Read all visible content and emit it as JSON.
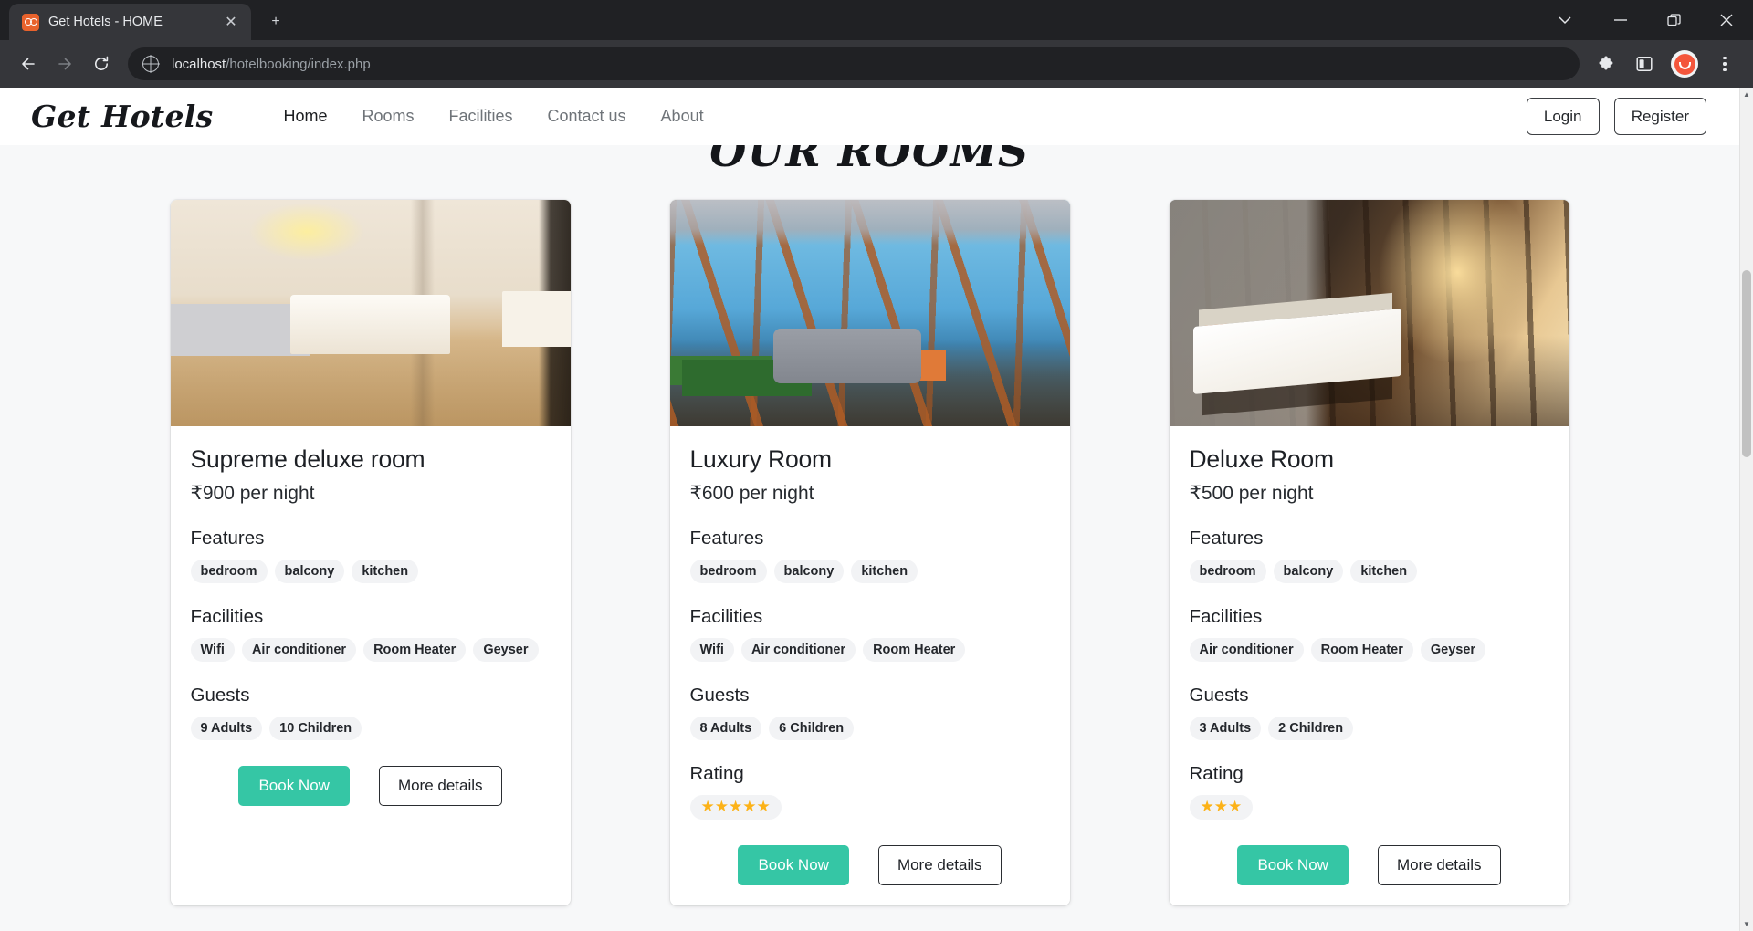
{
  "browser": {
    "tab": {
      "title": "Get Hotels - HOME",
      "favicon": "hotel-favicon",
      "close_label": "✕"
    },
    "new_tab_label": "+",
    "window_controls": {
      "tab_search": "⌄",
      "minimize": "—",
      "maximize": "❐",
      "close": "✕"
    },
    "nav": {
      "back": "←",
      "forward": "→",
      "reload": "↻"
    },
    "omnibox": {
      "host": "localhost",
      "path": "/hotelbooking/index.php",
      "full_url": "localhost/hotelbooking/index.php"
    },
    "toolbar_right": {
      "extensions": "puzzle-icon",
      "side_panel": "side-panel-icon",
      "profile": "profile-avatar",
      "menu": "kebab-menu"
    }
  },
  "site": {
    "logo": "Get Hotels",
    "nav_items": [
      {
        "label": "Home",
        "active": true
      },
      {
        "label": "Rooms",
        "active": false
      },
      {
        "label": "Facilities",
        "active": false
      },
      {
        "label": "Contact us",
        "active": false
      },
      {
        "label": "About",
        "active": false
      }
    ],
    "login_label": "Login",
    "register_label": "Register"
  },
  "main": {
    "section_title": "OUR ROOMS",
    "labels": {
      "features": "Features",
      "facilities": "Facilities",
      "guests": "Guests",
      "rating": "Rating"
    },
    "buttons": {
      "book": "Book Now",
      "details": "More details"
    },
    "accent_color": "#35c6a5",
    "star_color": "#fcb217",
    "star_glyph": "★",
    "rooms": [
      {
        "name": "Supreme deluxe room",
        "price": "₹900 per night",
        "image": "hotel-room-beige-twin-beds",
        "features": [
          "bedroom",
          "balcony",
          "kitchen"
        ],
        "facilities": [
          "Wifi",
          "Air conditioner",
          "Room Heater",
          "Geyser"
        ],
        "guests": [
          "9 Adults",
          "10 Children"
        ],
        "rating": 0
      },
      {
        "name": "Luxury Room",
        "price": "₹600 per night",
        "image": "sunroom-ocean-view-sofa",
        "features": [
          "bedroom",
          "balcony",
          "kitchen"
        ],
        "facilities": [
          "Wifi",
          "Air conditioner",
          "Room Heater"
        ],
        "guests": [
          "8 Adults",
          "6 Children"
        ],
        "rating": 5
      },
      {
        "name": "Deluxe Room",
        "price": "₹500 per night",
        "image": "dark-wood-bedroom-sunlight",
        "features": [
          "bedroom",
          "balcony",
          "kitchen"
        ],
        "facilities": [
          "Air conditioner",
          "Room Heater",
          "Geyser"
        ],
        "guests": [
          "3 Adults",
          "2 Children"
        ],
        "rating": 3
      }
    ]
  }
}
